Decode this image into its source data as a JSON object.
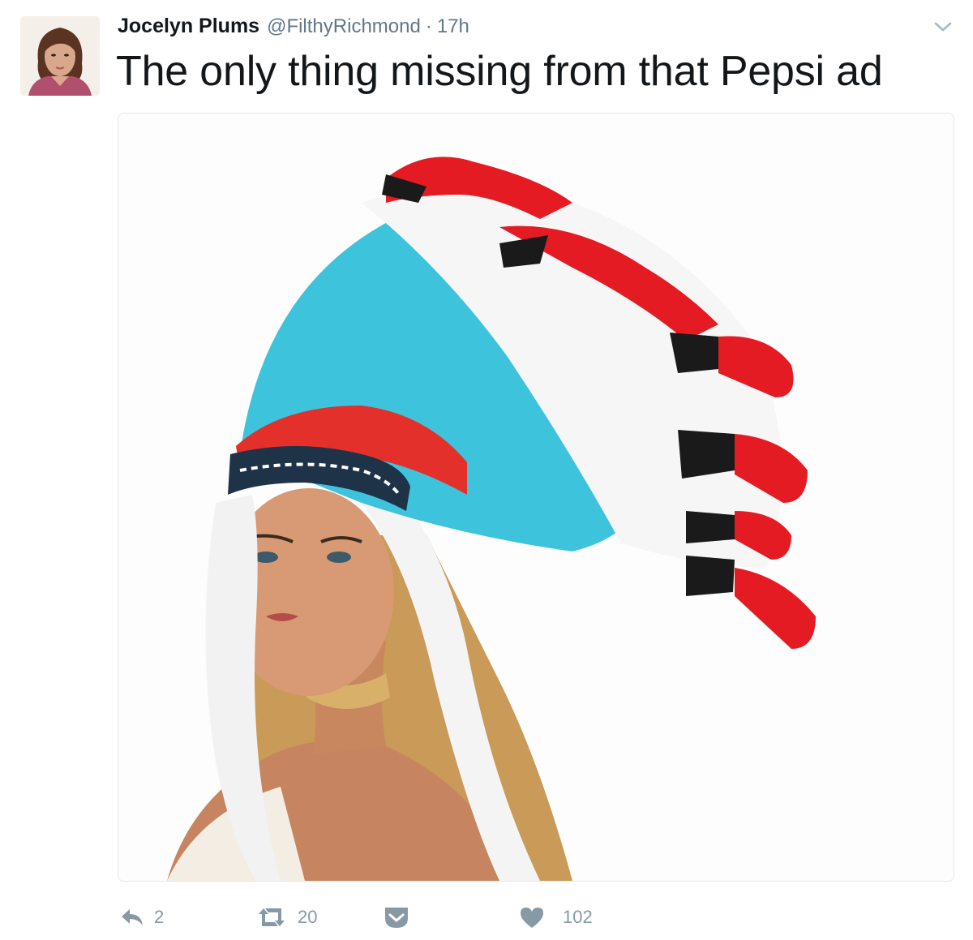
{
  "tweet": {
    "author_name": "Jocelyn Plums",
    "author_handle": "@FilthyRichmond",
    "separator": "·",
    "time": "17h",
    "text": "The only thing missing from that Pepsi ad",
    "avatar_icon": "user-avatar-photo",
    "media_description_icon": "photo-media"
  },
  "actions": {
    "reply_count": "2",
    "retweet_count": "20",
    "like_count": "102"
  },
  "colors": {
    "text_primary": "#14171a",
    "text_secondary": "#657786",
    "icon_gray": "#8899a6",
    "border": "#e1e8ed"
  }
}
